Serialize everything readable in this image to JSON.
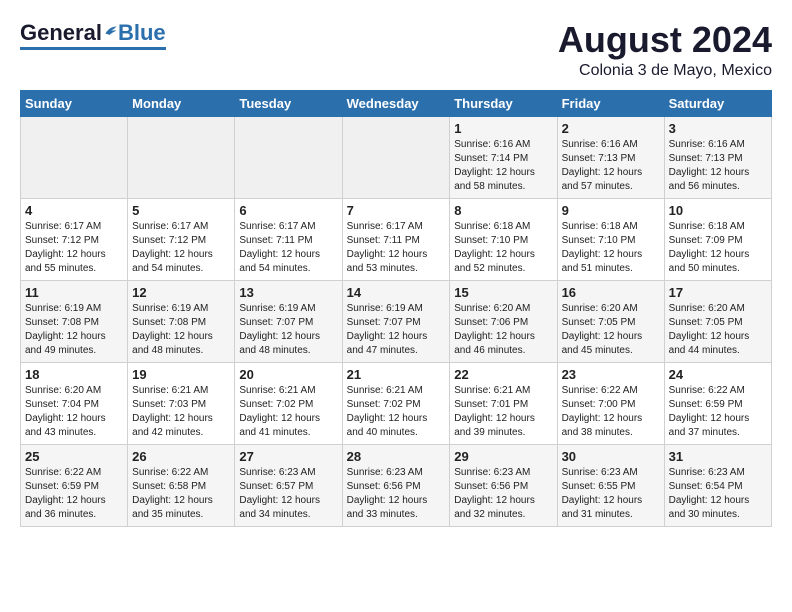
{
  "logo": {
    "general": "General",
    "blue": "Blue"
  },
  "title": {
    "month_year": "August 2024",
    "location": "Colonia 3 de Mayo, Mexico"
  },
  "days_of_week": [
    "Sunday",
    "Monday",
    "Tuesday",
    "Wednesday",
    "Thursday",
    "Friday",
    "Saturday"
  ],
  "weeks": [
    [
      {
        "day": "",
        "sunrise": "",
        "sunset": "",
        "daylight": ""
      },
      {
        "day": "",
        "sunrise": "",
        "sunset": "",
        "daylight": ""
      },
      {
        "day": "",
        "sunrise": "",
        "sunset": "",
        "daylight": ""
      },
      {
        "day": "",
        "sunrise": "",
        "sunset": "",
        "daylight": ""
      },
      {
        "day": "1",
        "sunrise": "Sunrise: 6:16 AM",
        "sunset": "Sunset: 7:14 PM",
        "daylight": "Daylight: 12 hours and 58 minutes."
      },
      {
        "day": "2",
        "sunrise": "Sunrise: 6:16 AM",
        "sunset": "Sunset: 7:13 PM",
        "daylight": "Daylight: 12 hours and 57 minutes."
      },
      {
        "day": "3",
        "sunrise": "Sunrise: 6:16 AM",
        "sunset": "Sunset: 7:13 PM",
        "daylight": "Daylight: 12 hours and 56 minutes."
      }
    ],
    [
      {
        "day": "4",
        "sunrise": "Sunrise: 6:17 AM",
        "sunset": "Sunset: 7:12 PM",
        "daylight": "Daylight: 12 hours and 55 minutes."
      },
      {
        "day": "5",
        "sunrise": "Sunrise: 6:17 AM",
        "sunset": "Sunset: 7:12 PM",
        "daylight": "Daylight: 12 hours and 54 minutes."
      },
      {
        "day": "6",
        "sunrise": "Sunrise: 6:17 AM",
        "sunset": "Sunset: 7:11 PM",
        "daylight": "Daylight: 12 hours and 54 minutes."
      },
      {
        "day": "7",
        "sunrise": "Sunrise: 6:17 AM",
        "sunset": "Sunset: 7:11 PM",
        "daylight": "Daylight: 12 hours and 53 minutes."
      },
      {
        "day": "8",
        "sunrise": "Sunrise: 6:18 AM",
        "sunset": "Sunset: 7:10 PM",
        "daylight": "Daylight: 12 hours and 52 minutes."
      },
      {
        "day": "9",
        "sunrise": "Sunrise: 6:18 AM",
        "sunset": "Sunset: 7:10 PM",
        "daylight": "Daylight: 12 hours and 51 minutes."
      },
      {
        "day": "10",
        "sunrise": "Sunrise: 6:18 AM",
        "sunset": "Sunset: 7:09 PM",
        "daylight": "Daylight: 12 hours and 50 minutes."
      }
    ],
    [
      {
        "day": "11",
        "sunrise": "Sunrise: 6:19 AM",
        "sunset": "Sunset: 7:08 PM",
        "daylight": "Daylight: 12 hours and 49 minutes."
      },
      {
        "day": "12",
        "sunrise": "Sunrise: 6:19 AM",
        "sunset": "Sunset: 7:08 PM",
        "daylight": "Daylight: 12 hours and 48 minutes."
      },
      {
        "day": "13",
        "sunrise": "Sunrise: 6:19 AM",
        "sunset": "Sunset: 7:07 PM",
        "daylight": "Daylight: 12 hours and 48 minutes."
      },
      {
        "day": "14",
        "sunrise": "Sunrise: 6:19 AM",
        "sunset": "Sunset: 7:07 PM",
        "daylight": "Daylight: 12 hours and 47 minutes."
      },
      {
        "day": "15",
        "sunrise": "Sunrise: 6:20 AM",
        "sunset": "Sunset: 7:06 PM",
        "daylight": "Daylight: 12 hours and 46 minutes."
      },
      {
        "day": "16",
        "sunrise": "Sunrise: 6:20 AM",
        "sunset": "Sunset: 7:05 PM",
        "daylight": "Daylight: 12 hours and 45 minutes."
      },
      {
        "day": "17",
        "sunrise": "Sunrise: 6:20 AM",
        "sunset": "Sunset: 7:05 PM",
        "daylight": "Daylight: 12 hours and 44 minutes."
      }
    ],
    [
      {
        "day": "18",
        "sunrise": "Sunrise: 6:20 AM",
        "sunset": "Sunset: 7:04 PM",
        "daylight": "Daylight: 12 hours and 43 minutes."
      },
      {
        "day": "19",
        "sunrise": "Sunrise: 6:21 AM",
        "sunset": "Sunset: 7:03 PM",
        "daylight": "Daylight: 12 hours and 42 minutes."
      },
      {
        "day": "20",
        "sunrise": "Sunrise: 6:21 AM",
        "sunset": "Sunset: 7:02 PM",
        "daylight": "Daylight: 12 hours and 41 minutes."
      },
      {
        "day": "21",
        "sunrise": "Sunrise: 6:21 AM",
        "sunset": "Sunset: 7:02 PM",
        "daylight": "Daylight: 12 hours and 40 minutes."
      },
      {
        "day": "22",
        "sunrise": "Sunrise: 6:21 AM",
        "sunset": "Sunset: 7:01 PM",
        "daylight": "Daylight: 12 hours and 39 minutes."
      },
      {
        "day": "23",
        "sunrise": "Sunrise: 6:22 AM",
        "sunset": "Sunset: 7:00 PM",
        "daylight": "Daylight: 12 hours and 38 minutes."
      },
      {
        "day": "24",
        "sunrise": "Sunrise: 6:22 AM",
        "sunset": "Sunset: 6:59 PM",
        "daylight": "Daylight: 12 hours and 37 minutes."
      }
    ],
    [
      {
        "day": "25",
        "sunrise": "Sunrise: 6:22 AM",
        "sunset": "Sunset: 6:59 PM",
        "daylight": "Daylight: 12 hours and 36 minutes."
      },
      {
        "day": "26",
        "sunrise": "Sunrise: 6:22 AM",
        "sunset": "Sunset: 6:58 PM",
        "daylight": "Daylight: 12 hours and 35 minutes."
      },
      {
        "day": "27",
        "sunrise": "Sunrise: 6:23 AM",
        "sunset": "Sunset: 6:57 PM",
        "daylight": "Daylight: 12 hours and 34 minutes."
      },
      {
        "day": "28",
        "sunrise": "Sunrise: 6:23 AM",
        "sunset": "Sunset: 6:56 PM",
        "daylight": "Daylight: 12 hours and 33 minutes."
      },
      {
        "day": "29",
        "sunrise": "Sunrise: 6:23 AM",
        "sunset": "Sunset: 6:56 PM",
        "daylight": "Daylight: 12 hours and 32 minutes."
      },
      {
        "day": "30",
        "sunrise": "Sunrise: 6:23 AM",
        "sunset": "Sunset: 6:55 PM",
        "daylight": "Daylight: 12 hours and 31 minutes."
      },
      {
        "day": "31",
        "sunrise": "Sunrise: 6:23 AM",
        "sunset": "Sunset: 6:54 PM",
        "daylight": "Daylight: 12 hours and 30 minutes."
      }
    ]
  ]
}
